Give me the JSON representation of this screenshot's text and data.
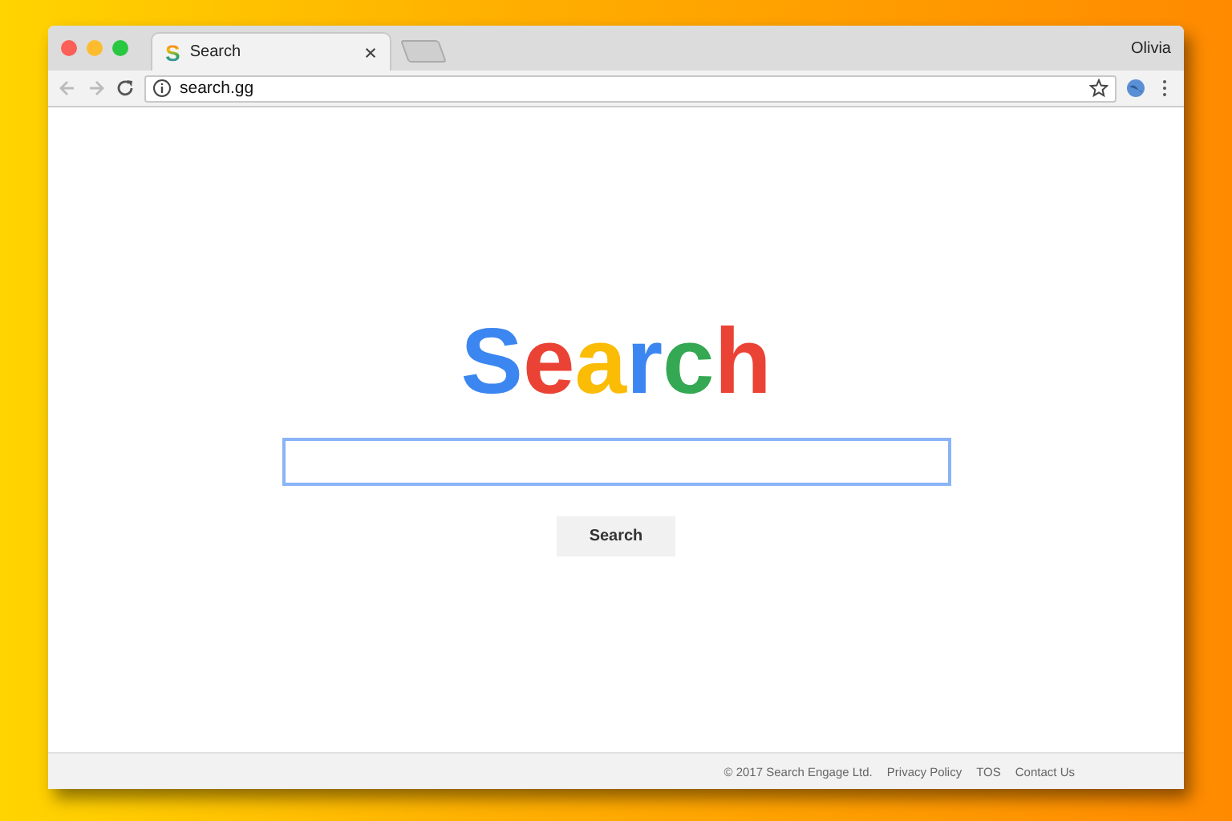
{
  "window": {
    "user": "Olivia"
  },
  "tabs": [
    {
      "favicon": "S",
      "title": "Search",
      "selected": true
    }
  ],
  "address_bar": {
    "url": "search.gg"
  },
  "logo": {
    "letters": [
      {
        "text": "S",
        "color": "#3b86f0"
      },
      {
        "text": "e",
        "color": "#ea4335"
      },
      {
        "text": "a",
        "color": "#fbbc05"
      },
      {
        "text": "r",
        "color": "#3b86f0"
      },
      {
        "text": "c",
        "color": "#34a853"
      },
      {
        "text": "h",
        "color": "#ea4335"
      }
    ]
  },
  "search_button": "Search",
  "footer": {
    "copyright": "© 2017 Search Engage Ltd.",
    "links": [
      "Privacy Policy",
      "TOS",
      "Contact Us"
    ]
  }
}
